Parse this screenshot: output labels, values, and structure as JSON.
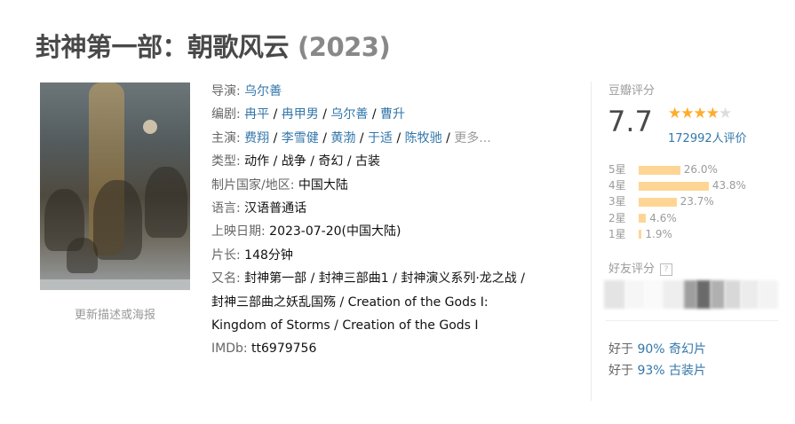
{
  "title": {
    "name": "封神第一部：朝歌风云",
    "year": "(2023)"
  },
  "sidebar": {
    "update_link": "更新描述或海报"
  },
  "info": {
    "director": {
      "label": "导演",
      "names": [
        "乌尔善"
      ]
    },
    "writers": {
      "label": "编剧",
      "names": [
        "冉平",
        "冉甲男",
        "乌尔善",
        "曹升"
      ]
    },
    "cast": {
      "label": "主演",
      "names": [
        "费翔",
        "李雪健",
        "黄渤",
        "于适",
        "陈牧驰"
      ],
      "more": "更多..."
    },
    "genre": {
      "label": "类型",
      "values": [
        "动作",
        "战争",
        "奇幻",
        "古装"
      ]
    },
    "country": {
      "label": "制片国家/地区",
      "value": "中国大陆"
    },
    "language": {
      "label": "语言",
      "value": "汉语普通话"
    },
    "release": {
      "label": "上映日期",
      "value": "2023-07-20(中国大陆)"
    },
    "runtime": {
      "label": "片长",
      "value": "148分钟"
    },
    "aka": {
      "label": "又名",
      "line1": "封神第一部 / 封神三部曲1 / 封神演义系列·龙之战 /",
      "line2": "封神三部曲之妖乱国殇 / Creation of the Gods Ⅰ:",
      "line3": "Kingdom of Storms / Creation of the Gods Ⅰ"
    },
    "imdb": {
      "label": "IMDb",
      "value": "tt6979756"
    }
  },
  "rating": {
    "header": "豆瓣评分",
    "score": "7.7",
    "stars": 4,
    "votes": "172992人评价",
    "accent_color": "#ffac2d",
    "bar_color": "#ffd596",
    "distribution": [
      {
        "label": "5星",
        "percent": "26.0%",
        "value": 26.0
      },
      {
        "label": "4星",
        "percent": "43.8%",
        "value": 43.8
      },
      {
        "label": "3星",
        "percent": "23.7%",
        "value": 23.7
      },
      {
        "label": "2星",
        "percent": "4.6%",
        "value": 4.6
      },
      {
        "label": "1星",
        "percent": "1.9%",
        "value": 1.9
      }
    ],
    "friends_header": "好友评分",
    "friends_help": "?",
    "better_than": [
      {
        "prefix": "好于",
        "percent": "90%",
        "genre": "奇幻片"
      },
      {
        "prefix": "好于",
        "percent": "93%",
        "genre": "古装片"
      }
    ]
  }
}
